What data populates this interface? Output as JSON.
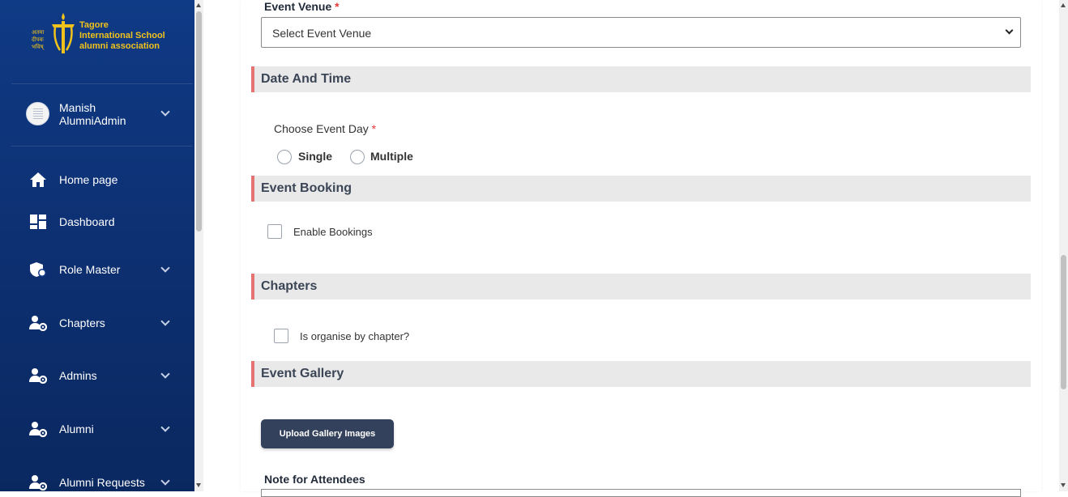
{
  "sidebar": {
    "logo": {
      "line1": "Tagore",
      "line2": "International School",
      "line3": "alumni association",
      "hindi1": "अतमा",
      "hindi2": "दीपवः",
      "hindi3": "भविष्",
      "color": "#f1c21b"
    },
    "user": {
      "first_name": "Manish",
      "last_name": "AlumniAdmin"
    },
    "items": [
      {
        "label": "Home page",
        "icon": "home-icon",
        "has_chevron": false
      },
      {
        "label": "Dashboard",
        "icon": "dashboard-icon",
        "has_chevron": false
      },
      {
        "label": "Role Master",
        "icon": "shield-user-icon",
        "has_chevron": true
      },
      {
        "label": "Chapters",
        "icon": "user-gear-icon",
        "has_chevron": true
      },
      {
        "label": "Admins",
        "icon": "user-gear-icon",
        "has_chevron": true
      },
      {
        "label": "Alumni",
        "icon": "user-gear-icon",
        "has_chevron": true
      },
      {
        "label": "Alumni Requests",
        "icon": "user-gear-icon",
        "has_chevron": true
      }
    ]
  },
  "form": {
    "event_venue_label": "Event Venue",
    "required_marker": "*",
    "event_venue_placeholder": "Select Event Venue",
    "sections": {
      "date_time": "Date And Time",
      "event_booking": "Event Booking",
      "chapters": "Chapters",
      "event_gallery": "Event Gallery"
    },
    "choose_event_day_label": "Choose Event Day",
    "event_day_options": [
      "Single",
      "Multiple"
    ],
    "enable_bookings_label": "Enable Bookings",
    "organise_by_chapter_label": "Is organise by chapter?",
    "upload_button_label": "Upload Gallery Images",
    "note_label": "Note for Attendees"
  },
  "colors": {
    "sidebar_bg": "#0f3a85",
    "section_accent": "#e57373",
    "section_bg": "#e9e9e9",
    "button_bg": "#33415c",
    "required": "#e53935"
  }
}
